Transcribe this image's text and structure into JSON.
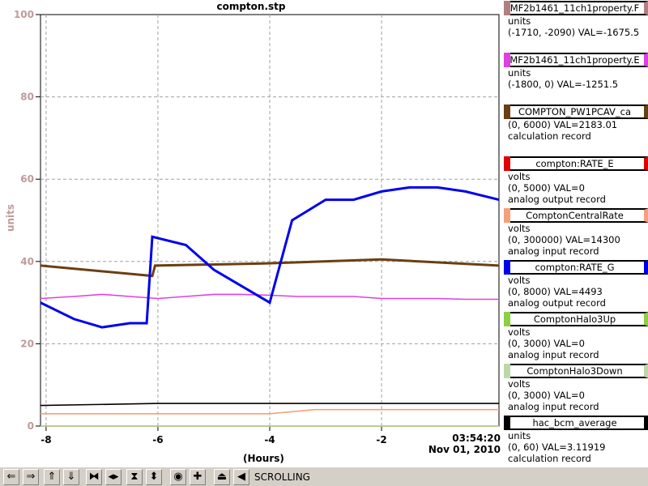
{
  "window": {
    "title": "compton.stp"
  },
  "chart_data": {
    "type": "line",
    "title": "compton.stp",
    "ylabel": "units",
    "xlabel": "(Hours)",
    "ylim": [
      0,
      100
    ],
    "xlim": [
      -8.1,
      0.1
    ],
    "y_ticks": [
      "0",
      "20",
      "40",
      "60",
      "80",
      "100"
    ],
    "x_ticks": [
      "-8",
      "-6",
      "-4",
      "-2"
    ],
    "x_tick_values": [
      -8,
      -6,
      -4,
      -2
    ],
    "end_time": "03:54:20",
    "end_date": "Nov 01, 2010",
    "grid": true,
    "legend_position": "right",
    "series": [
      {
        "name": "MF2b1461_11ch1property.F",
        "color": "#b08080",
        "x": [
          -8.1,
          -6.1,
          -4.1,
          -2,
          0.1
        ],
        "values": [
          null,
          null,
          null,
          null,
          null
        ]
      },
      {
        "name": "MF2b1461_11ch1property.E",
        "color": "#e040e0",
        "x": [
          -8.1,
          -7.5,
          -7,
          -6.5,
          -6,
          -5.5,
          -5,
          -4.5,
          -4,
          -3.5,
          -3,
          -2.5,
          -2,
          -1.5,
          -1,
          -0.5,
          0.1
        ],
        "values": [
          31,
          31.5,
          32,
          31.5,
          31,
          31.5,
          32,
          32,
          31.8,
          31.5,
          31.5,
          31.5,
          31,
          31,
          31,
          30.8,
          30.8
        ]
      },
      {
        "name": "COMPTON_PW1PCAV_ca",
        "color": "#6b3f12",
        "x": [
          -8.1,
          -6.1,
          -6.05,
          -4.1,
          -2,
          0.1
        ],
        "values": [
          39,
          36.5,
          39,
          39.5,
          40.5,
          39
        ]
      },
      {
        "name": "compton:RATE_E",
        "color": "#e00000",
        "x": [
          -8.1,
          0.1
        ],
        "values": [
          0,
          0
        ]
      },
      {
        "name": "ComptonCentralRate",
        "color": "#f5a07a",
        "x": [
          -8.1,
          -6,
          -4,
          -3.2,
          -2,
          -1,
          0.1
        ],
        "values": [
          3,
          3,
          3,
          4,
          4,
          4,
          4
        ]
      },
      {
        "name": "compton:RATE_G",
        "color": "#0000ee",
        "x": [
          -8.1,
          -7.5,
          -7,
          -6.5,
          -6.2,
          -6.1,
          -5.5,
          -5,
          -4.5,
          -4,
          -3.6,
          -3,
          -2.5,
          -2,
          -1.5,
          -1,
          -0.5,
          0.1
        ],
        "values": [
          30,
          26,
          24,
          25,
          25,
          46,
          44,
          38,
          34,
          30,
          50,
          55,
          55,
          57,
          58,
          58,
          57,
          55
        ]
      },
      {
        "name": "ComptonHalo3Up",
        "color": "#8ad040",
        "x": [
          -8.1,
          0.1
        ],
        "values": [
          0,
          0
        ]
      },
      {
        "name": "ComptonHalo3Down",
        "color": "#bcd8a8",
        "x": [
          -8.1,
          0.1
        ],
        "values": [
          0,
          0
        ]
      },
      {
        "name": "hac_bcm_average",
        "color": "#000000",
        "x": [
          -8.1,
          -6,
          -4,
          -2,
          0.1
        ],
        "values": [
          5,
          5.5,
          5.5,
          5.5,
          5.5
        ]
      }
    ]
  },
  "legend": [
    {
      "name": "MF2b1461_11ch1property.F",
      "color": "#b08080",
      "line1": "units",
      "line2": "(-1710, -2090) VAL=-1675.5",
      "line3": ""
    },
    {
      "name": "MF2b1461_11ch1property.E",
      "color": "#e040e0",
      "line1": "units",
      "line2": "(-1800, 0) VAL=-1251.5",
      "line3": ""
    },
    {
      "name": "COMPTON_PW1PCAV_ca",
      "color": "#6b3f12",
      "line1": "(0, 6000) VAL=2183.01",
      "line2": "calculation record",
      "line3": ""
    },
    {
      "name": "compton:RATE_E",
      "color": "#e00000",
      "line1": "volts",
      "line2": "(0, 5000) VAL=0",
      "line3": "analog output record"
    },
    {
      "name": "ComptonCentralRate",
      "color": "#f5a07a",
      "line1": "volts",
      "line2": "(0, 300000) VAL=14300",
      "line3": "analog input record"
    },
    {
      "name": "compton:RATE_G",
      "color": "#0000ee",
      "line1": "volts",
      "line2": "(0, 8000) VAL=4493",
      "line3": "analog output record"
    },
    {
      "name": "ComptonHalo3Up",
      "color": "#8ad040",
      "line1": "volts",
      "line2": "(0, 3000) VAL=0",
      "line3": "analog input record"
    },
    {
      "name": "ComptonHalo3Down",
      "color": "#bcd8a8",
      "line1": "volts",
      "line2": "(0, 3000) VAL=0",
      "line3": "analog input record"
    },
    {
      "name": "hac_bcm_average",
      "color": "#000000",
      "line1": "units",
      "line2": "(0, 60) VAL=3.11919",
      "line3": "calculation record"
    }
  ],
  "toolbar": {
    "status": "SCROLLING",
    "buttons": [
      {
        "name": "pan-left-button",
        "glyph": "⇐"
      },
      {
        "name": "pan-right-button",
        "glyph": "⇒"
      },
      {
        "name": "pan-up-button",
        "glyph": "⇑"
      },
      {
        "name": "pan-down-button",
        "glyph": "⇓"
      },
      {
        "name": "zoom-in-x-button",
        "glyph": "⧓"
      },
      {
        "name": "zoom-out-x-button",
        "glyph": "◂▸"
      },
      {
        "name": "zoom-in-y-button",
        "glyph": "⧗"
      },
      {
        "name": "zoom-out-y-button",
        "glyph": "⬍"
      },
      {
        "name": "autoscale-button",
        "glyph": "◉"
      },
      {
        "name": "reset-button",
        "glyph": "✚"
      },
      {
        "name": "toggle-scrolling-button",
        "glyph": "⏏"
      },
      {
        "name": "undo-button",
        "glyph": "◀"
      }
    ]
  }
}
